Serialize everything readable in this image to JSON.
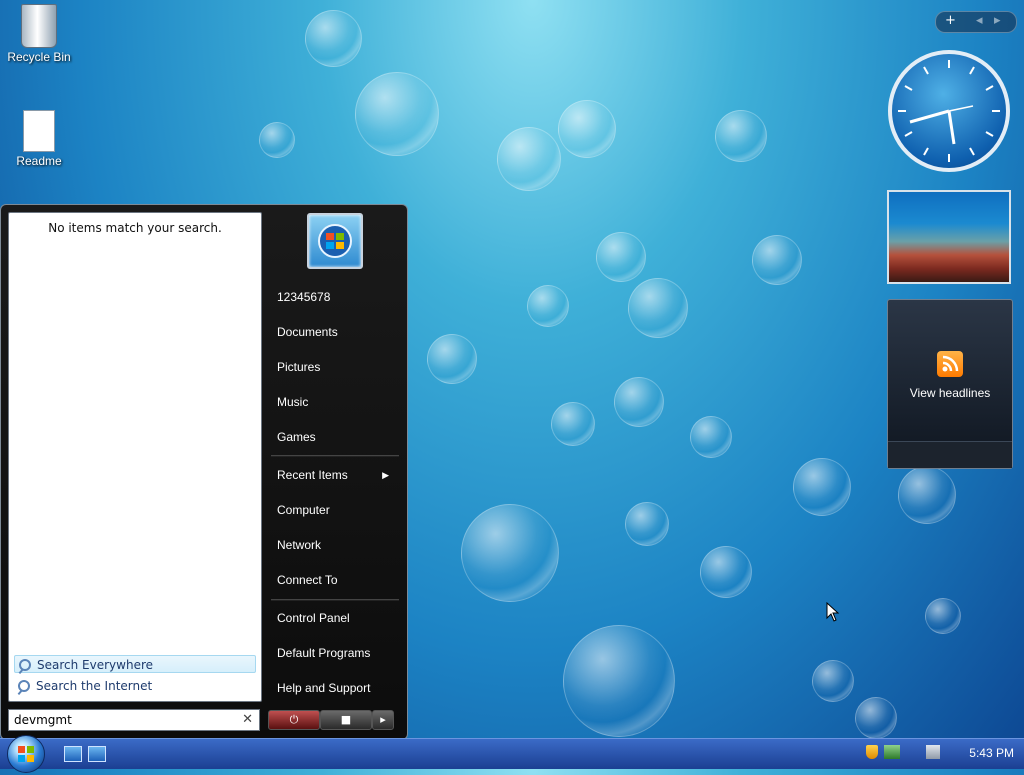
{
  "desktop": {
    "icons": [
      {
        "label": "Recycle Bin",
        "icon": "recycle-bin-icon"
      },
      {
        "label": "Readme",
        "icon": "text-document-icon"
      }
    ]
  },
  "start_menu": {
    "search_results": {
      "message": "No items match your search.",
      "options": [
        {
          "label": "Search Everywhere",
          "icon": "search-icon"
        },
        {
          "label": "Search the Internet",
          "icon": "search-icon"
        }
      ]
    },
    "search": {
      "value": "devmgmt"
    },
    "right_items": {
      "user": "12345678",
      "documents": "Documents",
      "pictures": "Pictures",
      "music": "Music",
      "games": "Games",
      "recent": "Recent Items",
      "computer": "Computer",
      "network": "Network",
      "connect": "Connect To",
      "control_panel": "Control Panel",
      "default_programs": "Default Programs",
      "help": "Help and Support"
    },
    "power_buttons": [
      "power-icon",
      "lock-icon",
      "arrow-right-icon"
    ]
  },
  "gadgets": {
    "feed_label": "View headlines",
    "clock_time": "5:43"
  },
  "taskbar": {
    "clock": "5:43 PM",
    "quick_launch": [
      "show-desktop-icon",
      "switch-windows-icon"
    ],
    "tray_icons": [
      "security-shield-icon",
      "network-icon",
      "volume-muted-icon"
    ]
  },
  "colors": {
    "accent": "#1c83c4",
    "rss": "#ff7b00"
  }
}
